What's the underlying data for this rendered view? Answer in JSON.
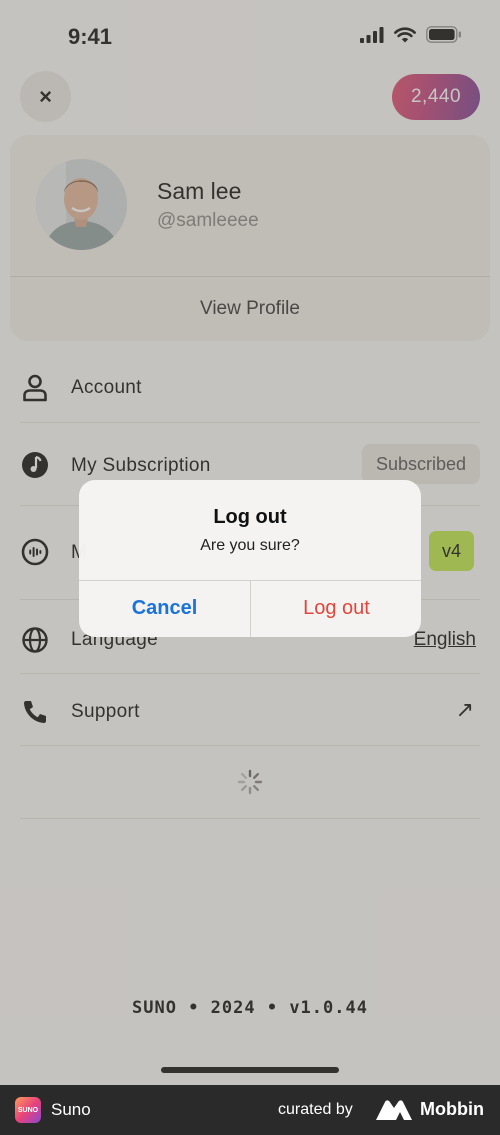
{
  "status_bar": {
    "time": "9:41"
  },
  "header": {
    "close_glyph": "×",
    "credits": "2,440"
  },
  "profile": {
    "name": "Sam lee",
    "handle": "@samleeee",
    "view_profile": "View Profile"
  },
  "menu": {
    "account": "Account",
    "subscription": "My Subscription",
    "subscription_badge": "Subscribed",
    "model_prefix": "M",
    "model_badge": "v4",
    "language": "Language",
    "language_value": "English",
    "support": "Support",
    "support_arrow": "↗"
  },
  "footer": {
    "version": "SUNO • 2024 • v1.0.44"
  },
  "dialog": {
    "title": "Log out",
    "message": "Are you sure?",
    "cancel": "Cancel",
    "confirm": "Log out"
  },
  "attribution": {
    "app_name": "Suno",
    "app_logo_text": "SUNO",
    "curated_by": "curated by",
    "brand": "Mobbin"
  },
  "colors": {
    "accent_blue": "#1a73d9",
    "destructive_red": "#e2453b",
    "model_badge": "#bde84a"
  }
}
